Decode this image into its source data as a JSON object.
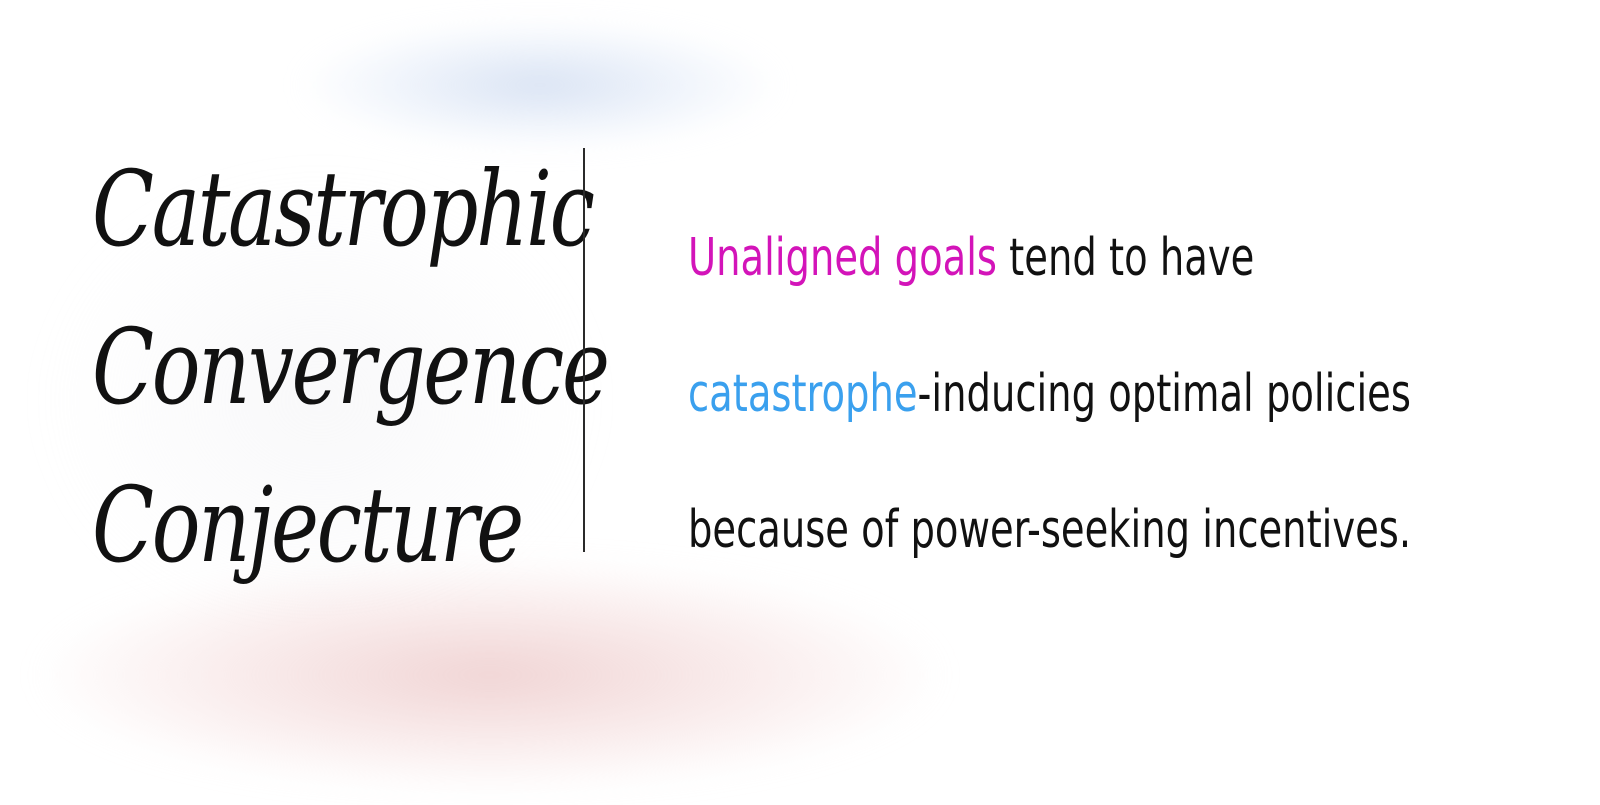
{
  "title": {
    "line1": "Catastrophic",
    "line2": "Convergence",
    "line3": "Conjecture"
  },
  "statement": {
    "line1_highlight": "Unaligned goals",
    "line1_rest": " tend to have",
    "line2_highlight": "catastrophe",
    "line2_rest": "-inducing optimal policies",
    "line3": "because of power-seeking incentives."
  },
  "colors": {
    "highlight_magenta": "#d314b9",
    "highlight_blue": "#3aa0ee",
    "ink": "#111111",
    "background": "#ffffff"
  }
}
